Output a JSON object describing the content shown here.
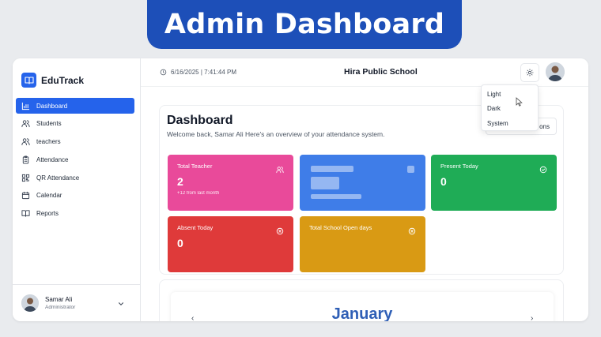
{
  "banner": {
    "title": "Admin Dashboard"
  },
  "brand": {
    "name": "EduTrack",
    "color": "#2563eb"
  },
  "sidebar": {
    "items": [
      {
        "label": "Dashboard",
        "icon": "bar-chart-icon",
        "active": true
      },
      {
        "label": "Students",
        "icon": "users-icon"
      },
      {
        "label": "teachers",
        "icon": "users-icon"
      },
      {
        "label": "Attendance",
        "icon": "clipboard-icon"
      },
      {
        "label": "QR Attendance",
        "icon": "qr-code-icon"
      },
      {
        "label": "Calendar",
        "icon": "calendar-icon"
      },
      {
        "label": "Reports",
        "icon": "book-icon"
      }
    ],
    "user": {
      "name": "Samar Ali",
      "role": "Administrator"
    }
  },
  "header": {
    "datetime": "6/16/2025 | 7:41:44 PM",
    "school": "Hira Public School",
    "theme_icon": "sun-icon"
  },
  "theme_menu": {
    "items": [
      "Light",
      "Dark",
      "System"
    ]
  },
  "dashboard": {
    "title": "Dashboard",
    "subtitle": "Welcome back, Samar Ali Here's an overview of your attendance system.",
    "quick_button_visible_text": "ons",
    "cards": {
      "total_teacher": {
        "label": "Total Teacher",
        "value": "2",
        "note": "+12 from last month",
        "color": "#e94a9a",
        "icon": "users-icon"
      },
      "loading": {
        "color": "#3f7de8"
      },
      "present_today": {
        "label": "Present Today",
        "value": "0",
        "color": "#1fac56",
        "icon": "check-circle-icon"
      },
      "absent_today": {
        "label": "Absent Today",
        "value": "0",
        "color": "#df3a3a",
        "icon": "x-circle-icon"
      },
      "school_open_days": {
        "label": "Total School Open days",
        "color": "#d99a14",
        "icon": "x-circle-icon"
      }
    }
  },
  "calendar": {
    "month": "January",
    "prev": "‹",
    "next": "›"
  }
}
